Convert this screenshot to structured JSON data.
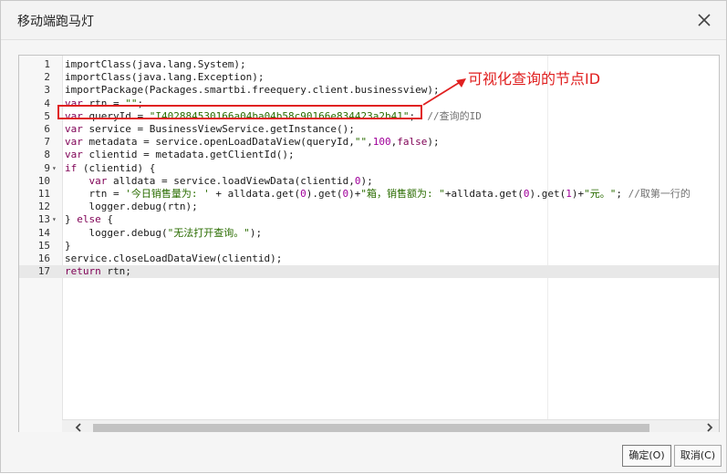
{
  "dialog": {
    "title": "移动端跑马灯",
    "close_icon": "close-icon"
  },
  "editor": {
    "active_line": 17,
    "lines": [
      {
        "n": "1",
        "fold": "",
        "tokens": [
          {
            "t": "importClass(java.lang.System);",
            "c": ""
          }
        ]
      },
      {
        "n": "2",
        "fold": "",
        "tokens": [
          {
            "t": "importClass(java.lang.Exception);",
            "c": ""
          }
        ]
      },
      {
        "n": "3",
        "fold": "",
        "tokens": [
          {
            "t": "importPackage(Packages.smartbi.freequery.client.businessview);",
            "c": ""
          }
        ]
      },
      {
        "n": "4",
        "fold": "",
        "tokens": [
          {
            "t": "var",
            "c": "kw"
          },
          {
            "t": " rtn = ",
            "c": ""
          },
          {
            "t": "\"\"",
            "c": "str"
          },
          {
            "t": ";",
            "c": ""
          }
        ]
      },
      {
        "n": "5",
        "fold": "",
        "tokens": [
          {
            "t": "var",
            "c": "kw"
          },
          {
            "t": " queryId = ",
            "c": ""
          },
          {
            "t": "\"I402884530166a04ba04b58c90166e834423a2b41\"",
            "c": "str"
          },
          {
            "t": ";  ",
            "c": ""
          },
          {
            "t": "//查询的ID",
            "c": "cmt"
          }
        ]
      },
      {
        "n": "6",
        "fold": "",
        "tokens": [
          {
            "t": "var",
            "c": "kw"
          },
          {
            "t": " service = BusinessViewService.getInstance();",
            "c": ""
          }
        ]
      },
      {
        "n": "7",
        "fold": "",
        "tokens": [
          {
            "t": "var",
            "c": "kw"
          },
          {
            "t": " metadata = service.openLoadDataView(queryId,",
            "c": ""
          },
          {
            "t": "\"\"",
            "c": "str"
          },
          {
            "t": ",",
            "c": ""
          },
          {
            "t": "100",
            "c": "num"
          },
          {
            "t": ",",
            "c": ""
          },
          {
            "t": "false",
            "c": "kw"
          },
          {
            "t": ");",
            "c": ""
          }
        ]
      },
      {
        "n": "8",
        "fold": "",
        "tokens": [
          {
            "t": "var",
            "c": "kw"
          },
          {
            "t": " clientid = metadata.getClientId();",
            "c": ""
          }
        ]
      },
      {
        "n": "9",
        "fold": "▾",
        "tokens": [
          {
            "t": "if",
            "c": "kw"
          },
          {
            "t": " (clientid) {",
            "c": ""
          }
        ]
      },
      {
        "n": "10",
        "fold": "",
        "tokens": [
          {
            "t": "    ",
            "c": ""
          },
          {
            "t": "var",
            "c": "kw"
          },
          {
            "t": " alldata = service.loadViewData(clientid,",
            "c": ""
          },
          {
            "t": "0",
            "c": "num"
          },
          {
            "t": ");",
            "c": ""
          }
        ]
      },
      {
        "n": "11",
        "fold": "",
        "tokens": [
          {
            "t": "    rtn = ",
            "c": ""
          },
          {
            "t": "'今日销售量为: '",
            "c": "str"
          },
          {
            "t": " + alldata.get(",
            "c": ""
          },
          {
            "t": "0",
            "c": "num"
          },
          {
            "t": ").get(",
            "c": ""
          },
          {
            "t": "0",
            "c": "num"
          },
          {
            "t": ")+",
            "c": ""
          },
          {
            "t": "\"箱，销售额为: \"",
            "c": "str"
          },
          {
            "t": "+alldata.get(",
            "c": ""
          },
          {
            "t": "0",
            "c": "num"
          },
          {
            "t": ").get(",
            "c": ""
          },
          {
            "t": "1",
            "c": "num"
          },
          {
            "t": ")+",
            "c": ""
          },
          {
            "t": "\"元。\"",
            "c": "str"
          },
          {
            "t": "; ",
            "c": ""
          },
          {
            "t": "//取第一行的",
            "c": "cmt"
          }
        ]
      },
      {
        "n": "12",
        "fold": "",
        "tokens": [
          {
            "t": "    logger.debug(rtn);",
            "c": ""
          }
        ]
      },
      {
        "n": "13",
        "fold": "▾",
        "tokens": [
          {
            "t": "} ",
            "c": ""
          },
          {
            "t": "else",
            "c": "kw"
          },
          {
            "t": " {",
            "c": ""
          }
        ]
      },
      {
        "n": "14",
        "fold": "",
        "tokens": [
          {
            "t": "    logger.debug(",
            "c": ""
          },
          {
            "t": "\"无法打开查询。\"",
            "c": "str"
          },
          {
            "t": ");",
            "c": ""
          }
        ]
      },
      {
        "n": "15",
        "fold": "",
        "tokens": [
          {
            "t": "}",
            "c": ""
          }
        ]
      },
      {
        "n": "16",
        "fold": "",
        "tokens": [
          {
            "t": "service.closeLoadDataView(clientid);",
            "c": ""
          }
        ]
      },
      {
        "n": "17",
        "fold": "",
        "tokens": [
          {
            "t": "return",
            "c": "kw"
          },
          {
            "t": " rtn;",
            "c": ""
          }
        ]
      }
    ]
  },
  "annotation": {
    "text": "可视化查询的节点ID",
    "color": "#e02020"
  },
  "scrollbar": {
    "left_icon": "chevron-left-icon",
    "right_icon": "chevron-right-icon"
  },
  "footer": {
    "ok_label": "确定(O)",
    "cancel_label": "取消(C)"
  }
}
